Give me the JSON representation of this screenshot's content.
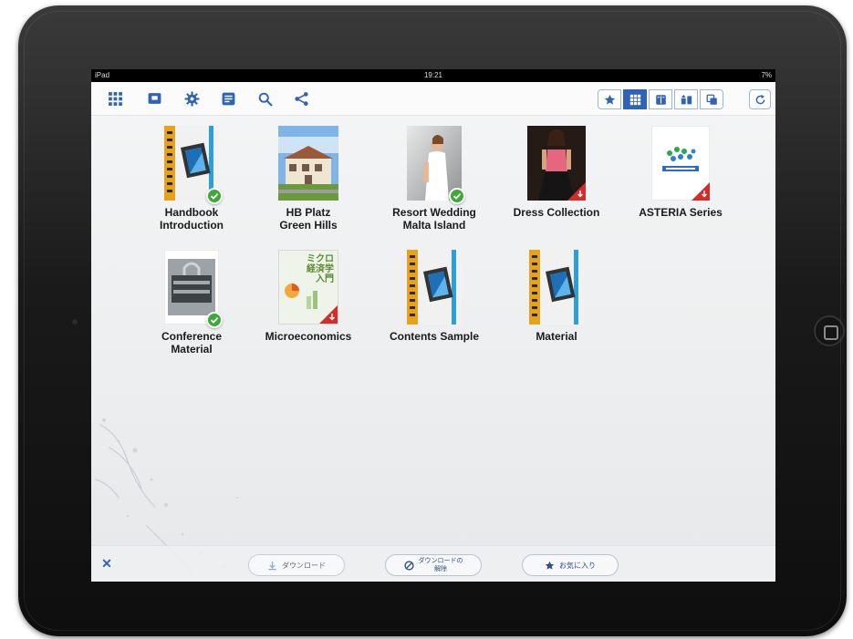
{
  "status_bar": {
    "carrier": "iPad",
    "time": "19:21",
    "battery": "7%"
  },
  "toolbar": {
    "left_icons": [
      "grid-icon",
      "slideshow-icon",
      "gear-icon",
      "note-icon",
      "search-icon",
      "share-icon"
    ],
    "view_segments": [
      {
        "icon": "star-icon",
        "active": false
      },
      {
        "icon": "grid-view-icon",
        "active": true
      },
      {
        "icon": "book-view-icon",
        "active": false
      },
      {
        "icon": "thumb-view-icon",
        "active": false
      },
      {
        "icon": "stack-view-icon",
        "active": false
      }
    ],
    "reload_icon": "reload-icon"
  },
  "library": {
    "items": [
      {
        "title": "Handbook\nIntroduction",
        "cover": "video",
        "downloaded": true
      },
      {
        "title": "HB Platz\nGreen Hills",
        "cover": "house-photo",
        "downloaded": false
      },
      {
        "title": "Resort Wedding\nMalta Island",
        "cover": "wedding-photo",
        "downloaded": true
      },
      {
        "title": "Dress Collection",
        "cover": "dress-photo",
        "downloaded": false,
        "download_marker": true
      },
      {
        "title": "ASTERIA Series",
        "cover": "asteria",
        "downloaded": false,
        "download_marker": true
      },
      {
        "title": "Conference\nMaterial",
        "cover": "lock-photo",
        "downloaded": true
      },
      {
        "title": "Microeconomics",
        "cover": "microeconomics",
        "cover_text": "ミクロ\n経済学\n入門",
        "downloaded": false,
        "download_marker": true
      },
      {
        "title": "Contents Sample",
        "cover": "video",
        "downloaded": false
      },
      {
        "title": "Material",
        "cover": "video",
        "downloaded": false
      }
    ]
  },
  "bottom_bar": {
    "close": "✕",
    "download": "ダウンロード",
    "remove_download": "ダウンロードの\n解除",
    "favorite": "お気に入り"
  },
  "colors": {
    "accent": "#2e63b8",
    "check": "#3fa83b",
    "corner": "#d42b2b"
  }
}
